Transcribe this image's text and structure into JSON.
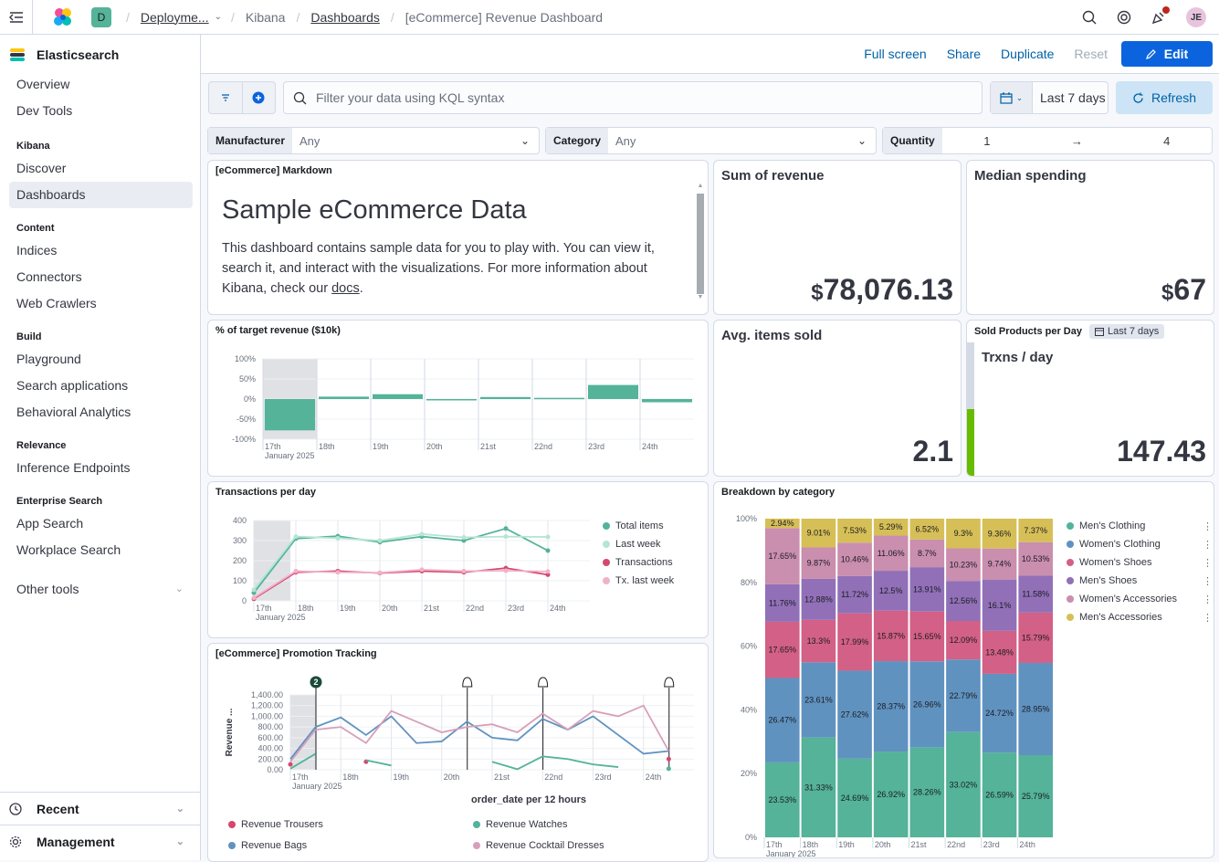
{
  "header": {
    "deployment_badge": "D",
    "breadcrumbs": [
      "Deployme...",
      "Kibana",
      "Dashboards",
      "[eCommerce] Revenue Dashboard"
    ],
    "avatar": "JE"
  },
  "sidebar": {
    "title": "Elasticsearch",
    "top_items": [
      "Overview",
      "Dev Tools"
    ],
    "sections": [
      {
        "name": "Kibana",
        "items": [
          "Discover",
          "Dashboards"
        ]
      },
      {
        "name": "Content",
        "items": [
          "Indices",
          "Connectors",
          "Web Crawlers"
        ]
      },
      {
        "name": "Build",
        "items": [
          "Playground",
          "Search applications",
          "Behavioral Analytics"
        ]
      },
      {
        "name": "Relevance",
        "items": [
          "Inference Endpoints"
        ]
      },
      {
        "name": "Enterprise Search",
        "items": [
          "App Search",
          "Workplace Search"
        ]
      }
    ],
    "other_tools": "Other tools",
    "recent": "Recent",
    "management": "Management"
  },
  "actions": {
    "full_screen": "Full screen",
    "share": "Share",
    "duplicate": "Duplicate",
    "reset": "Reset",
    "edit": "Edit"
  },
  "query": {
    "placeholder": "Filter your data using KQL syntax",
    "date_range": "Last 7 days",
    "refresh": "Refresh"
  },
  "controls": {
    "manufacturer": {
      "label": "Manufacturer",
      "value": "Any"
    },
    "category": {
      "label": "Category",
      "value": "Any"
    },
    "quantity": {
      "label": "Quantity",
      "from": "1",
      "arrow": "→",
      "to": "4"
    }
  },
  "panels": {
    "markdown": {
      "title": "[eCommerce] Markdown",
      "heading": "Sample eCommerce Data",
      "body_1": "This dashboard contains sample data for you to play with. You can view it, search it, and interact with the visualizations. For more information about Kibana, check our",
      "link": "docs",
      "end": "."
    },
    "revenue": {
      "title": "Sum of revenue",
      "currency": "$",
      "value": "78,076.13"
    },
    "median": {
      "title": "Median spending",
      "currency": "$",
      "value": "67"
    },
    "avg_items": {
      "title": "Avg. items sold",
      "value": "2.1"
    },
    "sold_per_day": {
      "title": "Sold Products per Day",
      "badge": "Last 7 days",
      "label": "Trxns / day",
      "value": "147.43"
    },
    "target": {
      "title": "% of target revenue ($10k)"
    },
    "transactions": {
      "title": "Transactions per day"
    },
    "breakdown": {
      "title": "Breakdown by category"
    },
    "promotion": {
      "title": "[eCommerce] Promotion Tracking",
      "xlabel": "order_date per 12 hours",
      "ylabel": "Revenue ...",
      "annotation_badge": "2"
    }
  },
  "chart_data": [
    {
      "type": "bar",
      "title": "% of target revenue ($10k)",
      "categories": [
        "17th",
        "18th",
        "19th",
        "20th",
        "21st",
        "22nd",
        "23rd",
        "24th"
      ],
      "values": [
        -78,
        6,
        12,
        -1,
        5,
        3,
        35,
        -8
      ],
      "ylim": [
        -100,
        100
      ],
      "yticks": [
        "100%",
        "50%",
        "0%",
        "-50%",
        "-100%"
      ],
      "subtitle_x": "January 2025",
      "color": "#54b399"
    },
    {
      "type": "line",
      "title": "Transactions per day",
      "categories": [
        "17th",
        "18th",
        "19th",
        "20th",
        "21st",
        "22nd",
        "23rd",
        "24th"
      ],
      "subtitle_x": "January 2025",
      "ylim": [
        0,
        400
      ],
      "yticks": [
        "400",
        "300",
        "200",
        "100",
        "0"
      ],
      "series": [
        {
          "name": "Total items",
          "color": "#54b399",
          "values": [
            40,
            310,
            322,
            292,
            320,
            300,
            360,
            250
          ]
        },
        {
          "name": "Last week",
          "color": "#b5e5d4",
          "values": [
            55,
            320,
            312,
            300,
            332,
            316,
            320,
            318
          ]
        },
        {
          "name": "Transactions",
          "color": "#d6476f",
          "values": [
            10,
            142,
            148,
            138,
            148,
            142,
            163,
            130
          ]
        },
        {
          "name": "Tx. last week",
          "color": "#f1b1c8",
          "values": [
            15,
            148,
            142,
            140,
            155,
            148,
            150,
            146
          ]
        }
      ]
    },
    {
      "type": "bar",
      "title": "Breakdown by category",
      "stacked": true,
      "percent": true,
      "categories": [
        "17th",
        "18th",
        "19th",
        "20th",
        "21st",
        "22nd",
        "23rd",
        "24th"
      ],
      "subtitle_x": "January 2025",
      "yticks": [
        "100%",
        "80%",
        "60%",
        "40%",
        "20%",
        "0%"
      ],
      "series": [
        {
          "name": "Men's Clothing",
          "color": "#54b399",
          "values": [
            23.53,
            31.33,
            24.69,
            26.92,
            28.26,
            33.02,
            26.59,
            25.79
          ]
        },
        {
          "name": "Women's Clothing",
          "color": "#6092c0",
          "values": [
            26.47,
            23.61,
            27.62,
            28.37,
            26.96,
            22.79,
            24.72,
            28.95
          ]
        },
        {
          "name": "Women's Shoes",
          "color": "#d36086",
          "values": [
            17.65,
            13.3,
            17.99,
            15.87,
            15.65,
            12.09,
            13.48,
            15.79
          ]
        },
        {
          "name": "Men's Shoes",
          "color": "#9170b8",
          "values": [
            11.76,
            12.88,
            11.72,
            12.5,
            13.91,
            12.56,
            16.1,
            11.58
          ]
        },
        {
          "name": "Women's Accessories",
          "color": "#ca8eae",
          "values": [
            17.65,
            9.87,
            10.46,
            11.06,
            8.7,
            10.23,
            9.74,
            10.53
          ]
        },
        {
          "name": "Men's Accessories",
          "color": "#d6bf57",
          "values": [
            2.94,
            9.01,
            7.53,
            5.29,
            6.52,
            9.3,
            9.36,
            7.37
          ]
        }
      ]
    },
    {
      "type": "line",
      "title": "[eCommerce] Promotion Tracking",
      "xlabel": "order_date per 12 hours",
      "ylabel": "Revenue ...",
      "subtitle_x": "January 2025",
      "x_ticks": [
        "17th",
        "18th",
        "19th",
        "20th",
        "21st",
        "22nd",
        "23rd",
        "24th"
      ],
      "yticks": [
        "1,400.00",
        "1,200.00",
        "1,000.00",
        "800.00",
        "600.00",
        "400.00",
        "200.00",
        "0.00"
      ],
      "ylim": [
        0,
        1400
      ],
      "series": [
        {
          "name": "Revenue Trousers",
          "color": "#d6476f",
          "values": [
            100,
            null,
            null,
            150,
            null,
            null,
            null,
            null,
            null,
            null,
            null,
            null,
            null,
            null,
            null,
            200
          ]
        },
        {
          "name": "Revenue Watches",
          "color": "#54b399",
          "values": [
            20,
            300,
            null,
            180,
            80,
            null,
            null,
            null,
            150,
            10,
            250,
            200,
            100,
            50,
            null,
            20
          ]
        },
        {
          "name": "Revenue Bags",
          "color": "#6092c0",
          "values": [
            200,
            800,
            980,
            650,
            1000,
            500,
            530,
            900,
            600,
            550,
            950,
            750,
            1000,
            650,
            300,
            350
          ]
        },
        {
          "name": "Revenue Cocktail Dresses",
          "color": "#d6a0b8",
          "values": [
            150,
            750,
            800,
            500,
            1100,
            900,
            700,
            800,
            850,
            700,
            1050,
            750,
            1100,
            1000,
            1200,
            350
          ]
        }
      ]
    }
  ]
}
